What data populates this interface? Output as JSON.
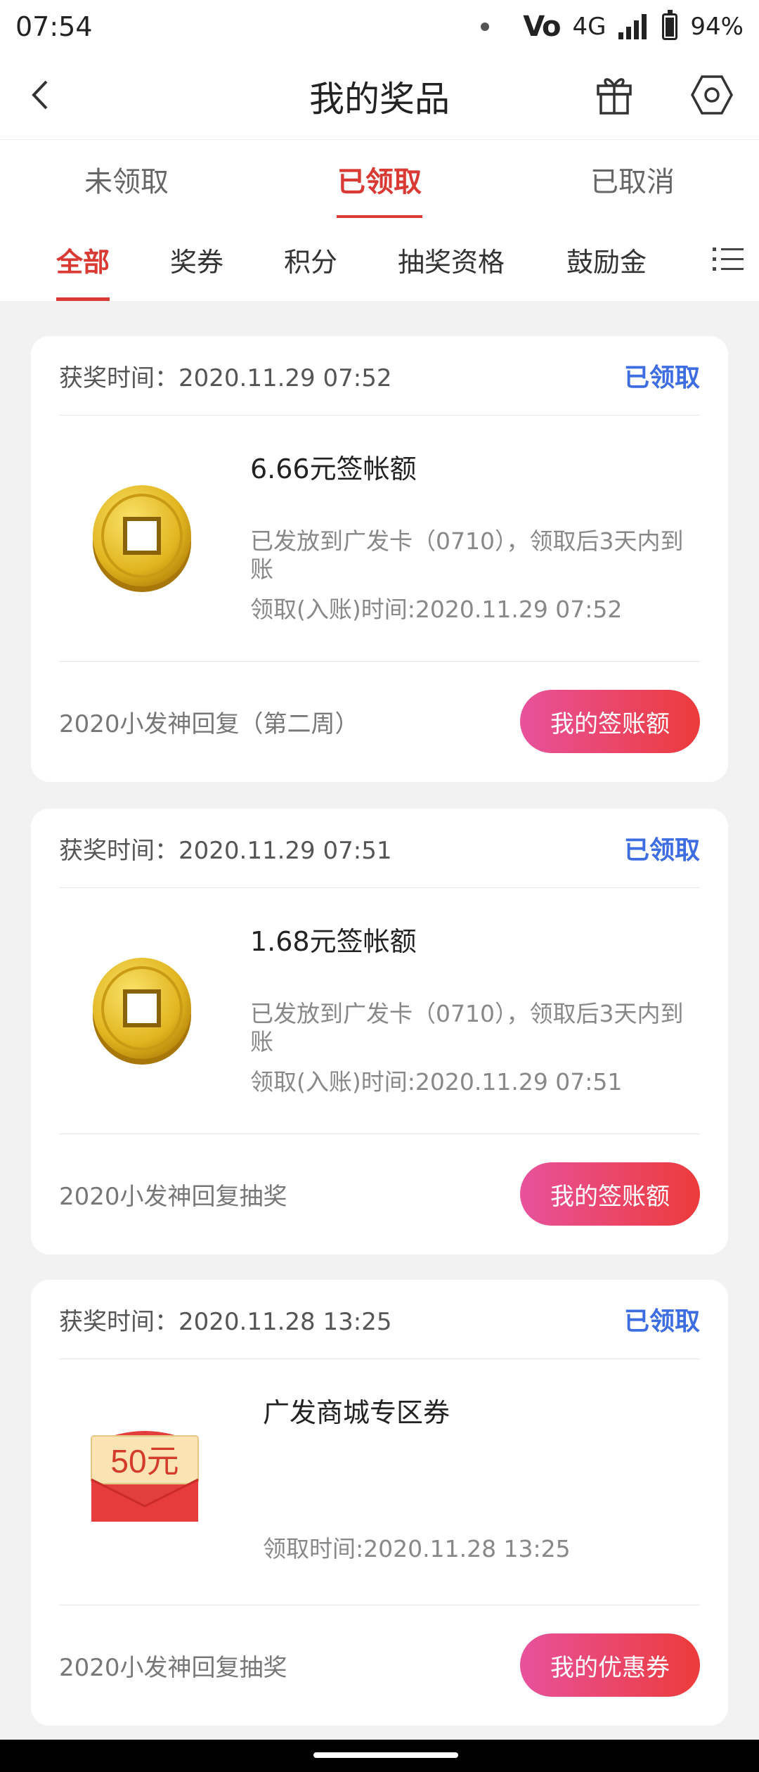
{
  "status_bar": {
    "time": "07:54",
    "network": "4G",
    "battery": "94%",
    "volte": "Vo"
  },
  "header": {
    "title": "我的奖品",
    "back_icon": "back-arrow-icon",
    "gift_icon": "gift-icon",
    "settings_icon": "hexagon-icon"
  },
  "tabs": [
    {
      "label": "未领取",
      "active": false
    },
    {
      "label": "已领取",
      "active": true
    },
    {
      "label": "已取消",
      "active": false
    }
  ],
  "categories": [
    {
      "label": "全部",
      "active": true
    },
    {
      "label": "奖券",
      "active": false
    },
    {
      "label": "积分",
      "active": false
    },
    {
      "label": "抽奖资格",
      "active": false
    },
    {
      "label": "鼓励金",
      "active": false
    }
  ],
  "colors": {
    "accent_red": "#d93a33",
    "status_blue": "#3d6de0",
    "button_gradient_start": "#e8529c",
    "button_gradient_end": "#ec3b3b"
  },
  "cards": [
    {
      "win_time": "获奖时间：2020.11.29 07:52",
      "status": "已领取",
      "prize_title": "6.66元签帐额",
      "prize_desc": "已发放到广发卡（0710），领取后3天内到账",
      "claim_time": "领取(入账)时间:2020.11.29 07:52",
      "campaign": "2020小发神回复（第二周）",
      "action": "我的签账额",
      "icon": "gold-coin-icon"
    },
    {
      "win_time": "获奖时间：2020.11.29 07:51",
      "status": "已领取",
      "prize_title": "1.68元签帐额",
      "prize_desc": "已发放到广发卡（0710），领取后3天内到账",
      "claim_time": "领取(入账)时间:2020.11.29 07:51",
      "campaign": "2020小发神回复抽奖",
      "action": "我的签账额",
      "icon": "gold-coin-icon"
    },
    {
      "win_time": "获奖时间：2020.11.28 13:25",
      "status": "已领取",
      "prize_title": "广发商城专区券",
      "prize_desc": "",
      "claim_time": "领取时间:2020.11.28 13:25",
      "campaign": "2020小发神回复抽奖",
      "action": "我的优惠券",
      "icon": "red-envelope-icon",
      "voucher_label": "50元"
    }
  ]
}
